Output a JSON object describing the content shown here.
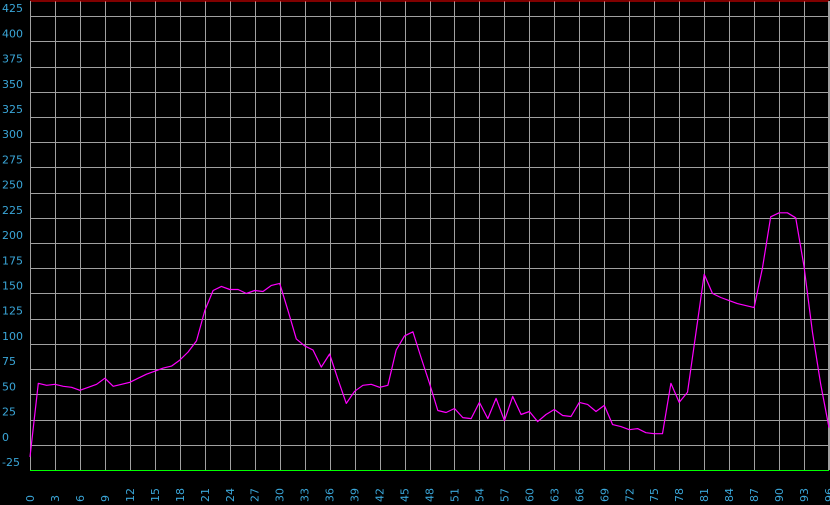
{
  "chart_data": {
    "type": "line",
    "title": "",
    "xlabel": "",
    "ylabel": "",
    "xlim": [
      0,
      96
    ],
    "ylim": [
      -25,
      440
    ],
    "grid": true,
    "colors": {
      "background": "#000000",
      "grid": "#a0a0a0",
      "line": "#ff00ff",
      "tick_label": "#3aa6d8",
      "top_border": "#ff0000",
      "bottom_border": "#00ff00"
    },
    "y_ticks": [
      -25,
      0,
      25,
      50,
      75,
      100,
      125,
      150,
      175,
      200,
      225,
      250,
      275,
      300,
      325,
      350,
      375,
      400,
      425
    ],
    "x_ticks": [
      0,
      3,
      6,
      9,
      12,
      15,
      18,
      21,
      24,
      27,
      30,
      33,
      36,
      39,
      42,
      45,
      48,
      51,
      54,
      57,
      60,
      63,
      66,
      69,
      72,
      75,
      78,
      81,
      84,
      87,
      90,
      93,
      96
    ],
    "series": [
      {
        "x": [
          0,
          1,
          2,
          3,
          4,
          5,
          6,
          7,
          8,
          9,
          10,
          11,
          12,
          13,
          14,
          15,
          16,
          17,
          18,
          19,
          20,
          21,
          22,
          23,
          24,
          25,
          26,
          27,
          28,
          29,
          30,
          31,
          32,
          33,
          34,
          35,
          36,
          37,
          38,
          39,
          40,
          41,
          42,
          43,
          44,
          45,
          46,
          47,
          48,
          49,
          50,
          51,
          52,
          53,
          54,
          55,
          56,
          57,
          58,
          59,
          60,
          61,
          62,
          63,
          64,
          65,
          66,
          67,
          68,
          69,
          70,
          71,
          72,
          73,
          74,
          75,
          76,
          77,
          78,
          79,
          80,
          81,
          82,
          83,
          84,
          85,
          86,
          87,
          88,
          89,
          90,
          91,
          92,
          93,
          94,
          95,
          96
        ],
        "values": [
          -12,
          61,
          59,
          60,
          58,
          57,
          54,
          57,
          60,
          66,
          58,
          60,
          62,
          66,
          70,
          73,
          76,
          78,
          84,
          92,
          103,
          133,
          153,
          157,
          154,
          154,
          150,
          153,
          152,
          158,
          160,
          133,
          105,
          98,
          94,
          77,
          90,
          65,
          41,
          53,
          59,
          60,
          57,
          59,
          94,
          108,
          112,
          86,
          61,
          34,
          32,
          36,
          27,
          26,
          42,
          26,
          46,
          24,
          48,
          30,
          33,
          23,
          30,
          35,
          29,
          28,
          42,
          40,
          33,
          39,
          20,
          18,
          15,
          16,
          12,
          11,
          11,
          61,
          42,
          52,
          110,
          169,
          150,
          146,
          143,
          140,
          138,
          136,
          175,
          226,
          230,
          230,
          225,
          177,
          112,
          60,
          17
        ]
      }
    ]
  }
}
